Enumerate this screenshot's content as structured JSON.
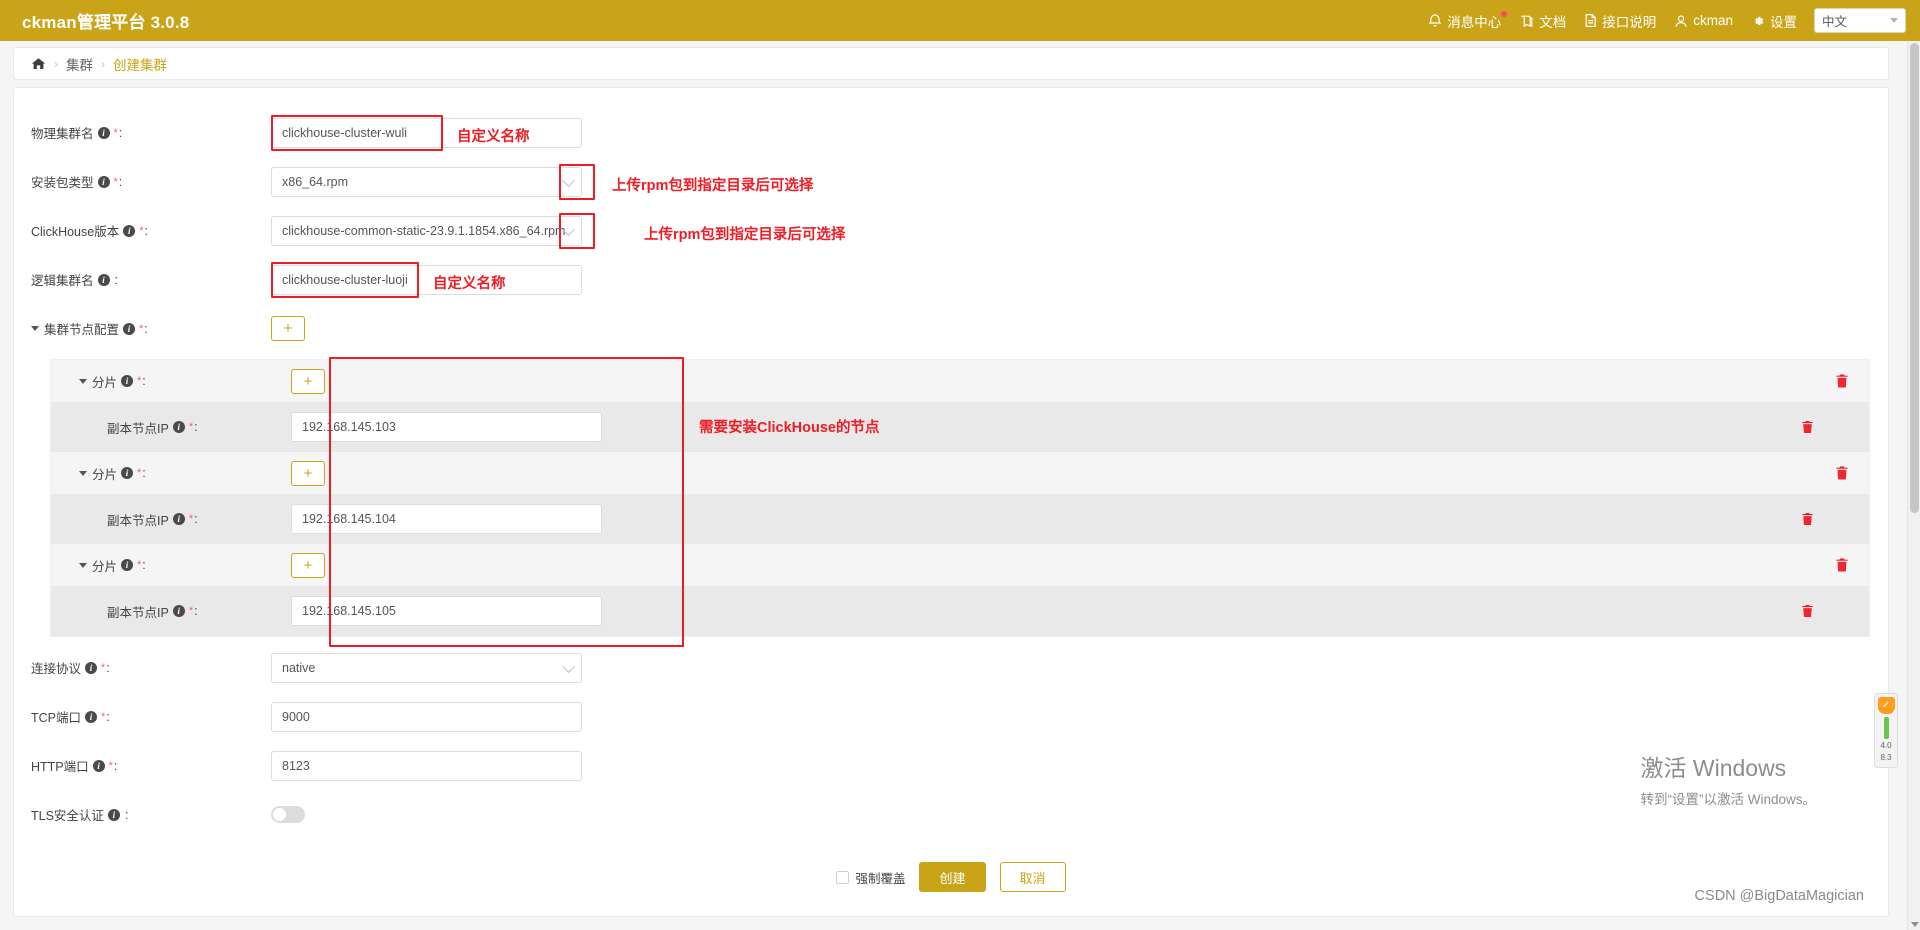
{
  "header": {
    "brand": "ckman管理平台 3.0.8",
    "nav": [
      {
        "id": "message-center",
        "label": "消息中心",
        "icon": "bell-icon",
        "badge": true
      },
      {
        "id": "docs",
        "label": "文档",
        "icon": "book-icon",
        "badge": false
      },
      {
        "id": "api",
        "label": "接口说明",
        "icon": "file-icon",
        "badge": false
      },
      {
        "id": "user",
        "label": "ckman",
        "icon": "user-icon",
        "badge": false
      },
      {
        "id": "settings",
        "label": "设置",
        "icon": "gear-icon",
        "badge": false
      }
    ],
    "language": {
      "value": "中文"
    },
    "accent_color": "#c9a419"
  },
  "breadcrumb": {
    "home_icon": "home-icon",
    "items": [
      "集群",
      "创建集群"
    ]
  },
  "form": {
    "physical_cluster": {
      "label": "物理集群名",
      "required": "*",
      "value": "clickhouse-cluster-wuli",
      "annotation": "自定义名称"
    },
    "package_type": {
      "label": "安装包类型",
      "required": "*",
      "value": "x86_64.rpm",
      "annotation": "上传rpm包到指定目录后可选择"
    },
    "clickhouse_version": {
      "label": "ClickHouse版本",
      "required": "*",
      "value": "clickhouse-common-static-23.9.1.1854.x86_64.rpm",
      "annotation": "上传rpm包到指定目录后可选择"
    },
    "logical_cluster": {
      "label": "逻辑集群名",
      "required": "",
      "value": "clickhouse-cluster-luoji",
      "annotation": "自定义名称"
    },
    "node_config": {
      "label": "集群节点配置",
      "required": "*",
      "add_label": "+"
    },
    "shard_label": "分片",
    "shard_required": "*",
    "replica_label": "副本节点IP",
    "replica_required": "*",
    "shards": [
      {
        "add_label": "+",
        "replicas": [
          {
            "ip": "192.168.145.103"
          }
        ]
      },
      {
        "add_label": "+",
        "replicas": [
          {
            "ip": "192.168.145.104"
          }
        ]
      },
      {
        "add_label": "+",
        "replicas": [
          {
            "ip": "192.168.145.105"
          }
        ]
      }
    ],
    "shards_annotation": "需要安装ClickHouse的节点",
    "protocol": {
      "label": "连接协议",
      "required": "*",
      "value": "native"
    },
    "tcp_port": {
      "label": "TCP端口",
      "required": "*",
      "value": "9000"
    },
    "http_port": {
      "label": "HTTP端口",
      "required": "*",
      "value": "8123"
    },
    "tls": {
      "label": "TLS安全认证",
      "required": "",
      "enabled": false
    }
  },
  "footer": {
    "force_overwrite_label": "强制覆盖",
    "create_label": "创建",
    "cancel_label": "取消"
  },
  "watermark": {
    "line1": "激活 Windows",
    "line2": "转到“设置”以激活 Windows。"
  },
  "attribution": "CSDN @BigDataMagician",
  "float_widget": {
    "value_top": "4.0",
    "value_bottom": "8.3"
  }
}
